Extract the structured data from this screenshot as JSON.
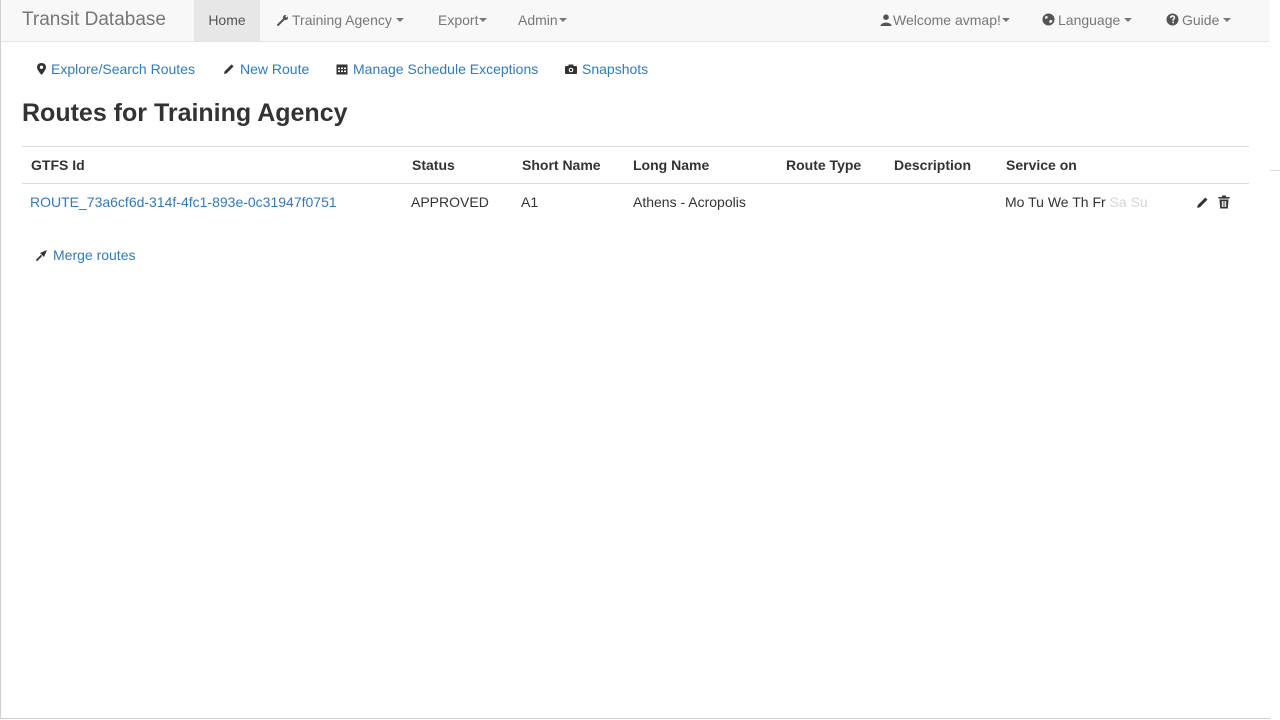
{
  "navbar": {
    "brand": "Transit Database",
    "home": "Home",
    "agency_menu": "Training Agency",
    "export_menu": "Export",
    "admin_menu": "Admin",
    "user_menu": "Welcome avmap!",
    "language_menu": "Language",
    "guide_menu": "Guide"
  },
  "submenu": {
    "explore": "Explore/Search Routes",
    "new_route": "New Route",
    "exceptions": "Manage Schedule Exceptions",
    "snapshots": "Snapshots"
  },
  "page_title": "Routes for Training Agency",
  "table": {
    "columns": [
      "GTFS Id",
      "Status",
      "Short Name",
      "Long Name",
      "Route Type",
      "Description",
      "Service on"
    ],
    "rows": [
      {
        "gtfs_id": "ROUTE_73a6cf6d-314f-4fc1-893e-0c31947f0751",
        "status": "APPROVED",
        "short_name": "A1",
        "long_name": "Athens - Acropolis",
        "route_type": "",
        "description": "",
        "service_days": [
          {
            "label": "Mo",
            "active": true
          },
          {
            "label": "Tu",
            "active": true
          },
          {
            "label": "We",
            "active": true
          },
          {
            "label": "Th",
            "active": true
          },
          {
            "label": "Fr",
            "active": true
          },
          {
            "label": "Sa",
            "active": false
          },
          {
            "label": "Su",
            "active": false
          }
        ]
      }
    ]
  },
  "merge_label": "Merge routes",
  "colors": {
    "link": "#337ab7",
    "navbar_bg": "#f8f8f8",
    "active_nav_bg": "#e7e7e7",
    "inactive_day": "#d5d5d5"
  },
  "icons": {
    "agency": "wrench-icon",
    "user": "user-icon",
    "language": "globe-icon",
    "guide": "question-circle-icon",
    "explore": "map-marker-icon",
    "new_route": "pencil-icon",
    "exceptions": "calendar-icon",
    "snapshots": "camera-icon",
    "edit": "pencil-icon",
    "delete": "trash-icon",
    "merge": "merge-icon"
  }
}
